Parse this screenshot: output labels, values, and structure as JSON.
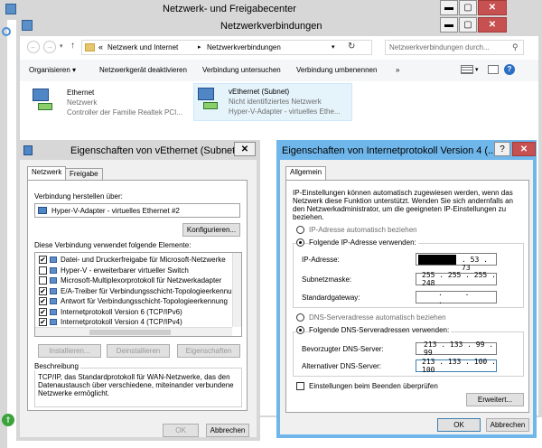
{
  "bg_window": {
    "title": "Netzwerk- und Freigabecenter"
  },
  "net_window": {
    "title": "Netzwerkverbindungen",
    "breadcrumb_sep": "«",
    "breadcrumb": [
      "Netzwerk und Internet",
      "Netzwerkverbindungen"
    ],
    "search_placeholder": "Netzwerkverbindungen durch...",
    "toolbar": [
      "Organisieren ▾",
      "Netzwerkgerät deaktivieren",
      "Verbindung untersuchen",
      "Verbindung umbenennen",
      "»"
    ],
    "adapters": [
      {
        "name": "Ethernet",
        "status": "Netzwerk",
        "device": "Controller der Familie Realtek PCI..."
      },
      {
        "name": "vEthernet (Subnet)",
        "status": "Nicht identifiziertes Netzwerk",
        "device": "Hyper-V-Adapter - virtuelles Ethe..."
      }
    ]
  },
  "props": {
    "title": "Eigenschaften von vEthernet (Subnet)",
    "tabs": [
      "Netzwerk",
      "Freigabe"
    ],
    "connect_label": "Verbindung herstellen über:",
    "adapter_name": "Hyper-V-Adapter - virtuelles Ethernet #2",
    "configure": "Konfigurieren...",
    "items_label": "Diese Verbindung verwendet folgende Elemente:",
    "items": [
      {
        "checked": true,
        "text": "Datei- und Druckerfreigabe für Microsoft-Netzwerke"
      },
      {
        "checked": false,
        "text": "Hyper-V - erweiterbarer virtueller Switch"
      },
      {
        "checked": false,
        "text": "Microsoft-Multiplexorprotokoll für Netzwerkadapter"
      },
      {
        "checked": true,
        "text": "E/A-Treiber für Verbindungsschicht-Topologieerkennur"
      },
      {
        "checked": true,
        "text": "Antwort für Verbindungsschicht-Topologieerkennung"
      },
      {
        "checked": true,
        "text": "Internetprotokoll Version 6 (TCP/IPv6)"
      },
      {
        "checked": true,
        "text": "Internetprotokoll Version 4 (TCP/IPv4)"
      }
    ],
    "btn_install": "Installieren...",
    "btn_uninstall": "Deinstallieren",
    "btn_properties": "Eigenschaften",
    "desc_title": "Beschreibung",
    "description": "TCP/IP, das Standardprotokoll für WAN-Netzwerke, das den Datenaustausch über verschiedene, miteinander verbundene Netzwerke ermöglicht.",
    "ok": "OK",
    "cancel": "Abbrechen"
  },
  "ipv4": {
    "title": "Eigenschaften von Internetprotokoll Version 4 (...",
    "help": "?",
    "tab": "Allgemein",
    "intro": "IP-Einstellungen können automatisch zugewiesen werden, wenn das Netzwerk diese Funktion unterstützt. Wenden Sie sich andernfalls an den Netzwerkadministrator, um die geeigneten IP-Einstellungen zu beziehen.",
    "radio_auto_ip": "IP-Adresse automatisch beziehen",
    "radio_manual_ip": "Folgende IP-Adresse verwenden:",
    "ip_label": "IP-Adresse:",
    "ip_value": ". 53 . 73",
    "mask_label": "Subnetzmaske:",
    "mask_value": "255 . 255 . 255 . 248",
    "gw_label": "Standardgateway:",
    "gw_value": ". . .",
    "radio_auto_dns": "DNS-Serveradresse automatisch beziehen",
    "radio_manual_dns": "Folgende DNS-Serveradressen verwenden:",
    "dns1_label": "Bevorzugter DNS-Server:",
    "dns1_value": "213 . 133 . 99 . 99",
    "dns2_label": "Alternativer DNS-Server:",
    "dns2_value": "213 . 133 . 100 . 100",
    "validate": "Einstellungen beim Beenden überprüfen",
    "advanced": "Erweitert...",
    "ok": "OK",
    "cancel": "Abbrechen"
  },
  "colors": {
    "accent": "#6fb6ea",
    "close": "#c75050",
    "selection": "#cce8ff"
  }
}
